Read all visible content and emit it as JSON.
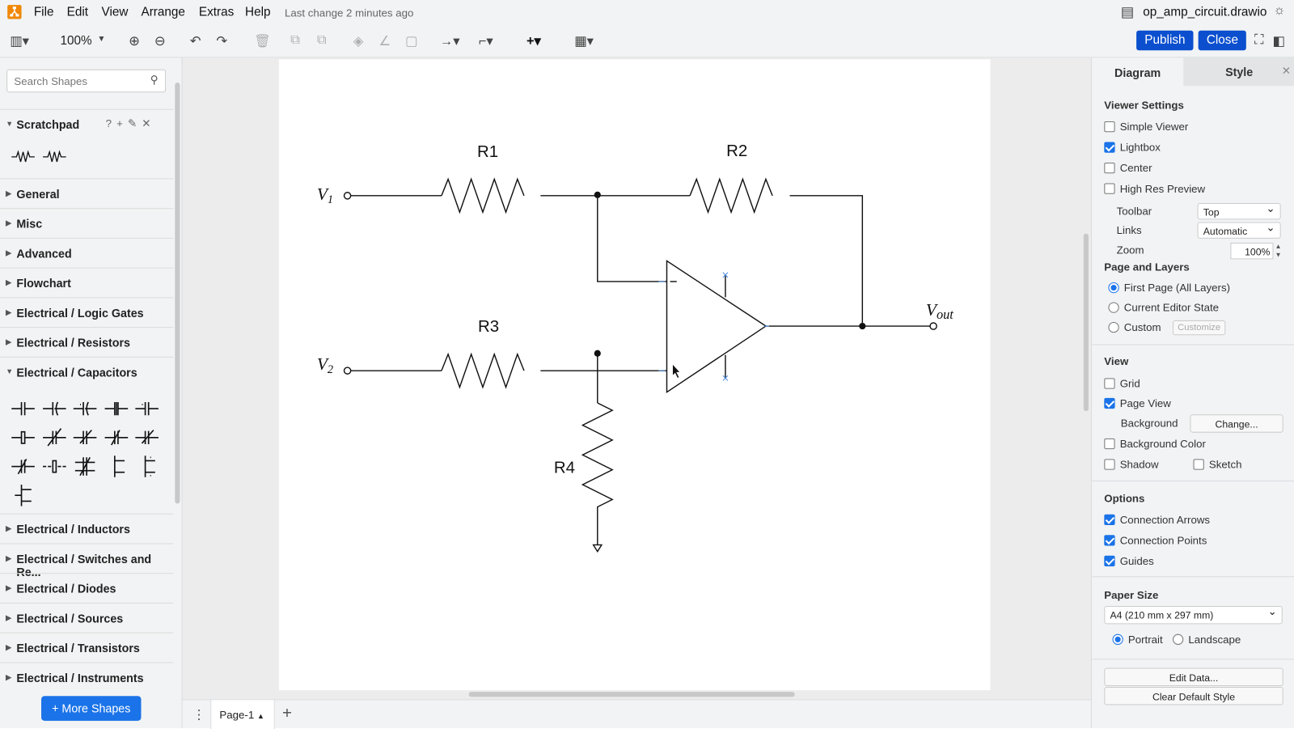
{
  "app": {
    "menus": [
      "File",
      "Edit",
      "View",
      "Arrange",
      "Extras",
      "Help"
    ],
    "last_change": "Last change 2 minutes ago",
    "file_name": "op_amp_circuit.drawio",
    "brand_color": "#f08705",
    "accent": "#0b4fcf"
  },
  "toolbar": {
    "zoom": "100%",
    "publish": "Publish",
    "close": "Close"
  },
  "sidebar": {
    "search_placeholder": "Search Shapes",
    "scratchpad": "Scratchpad",
    "sections": [
      "General",
      "Misc",
      "Advanced",
      "Flowchart",
      "Electrical / Logic Gates",
      "Electrical / Resistors",
      "Electrical / Capacitors",
      "Electrical / Inductors",
      "Electrical / Switches and Re...",
      "Electrical / Diodes",
      "Electrical / Sources",
      "Electrical / Transistors",
      "Electrical / Instruments"
    ],
    "more_shapes": "+ More Shapes"
  },
  "diagram": {
    "labels": {
      "r1": "R1",
      "r2": "R2",
      "r3": "R3",
      "r4": "R4",
      "v1": "V",
      "v1_sub": "1",
      "v2": "V",
      "v2_sub": "2",
      "vout": "V",
      "vout_sub": "out"
    }
  },
  "bottom": {
    "page_tab": "Page-1"
  },
  "panel": {
    "tabs": [
      "Diagram",
      "Style"
    ],
    "viewer_settings": "Viewer Settings",
    "viewer": [
      {
        "label": "Simple Viewer",
        "checked": false
      },
      {
        "label": "Lightbox",
        "checked": true
      },
      {
        "label": "Center",
        "checked": false
      },
      {
        "label": "High Res Preview",
        "checked": false
      }
    ],
    "toolbar_label": "Toolbar",
    "toolbar_value": "Top",
    "links_label": "Links",
    "links_value": "Automatic",
    "zoom_label": "Zoom",
    "zoom_value": "100%",
    "page_layers": "Page and Layers",
    "layers": [
      {
        "label": "First Page (All Layers)",
        "checked": true
      },
      {
        "label": "Current Editor State",
        "checked": false
      },
      {
        "label": "Custom",
        "checked": false
      }
    ],
    "customize": "Customize",
    "view": "View",
    "grid": "Grid",
    "page_view": "Page View",
    "background": "Background",
    "change": "Change...",
    "background_color": "Background Color",
    "shadow": "Shadow",
    "sketch": "Sketch",
    "options": "Options",
    "opts": [
      {
        "label": "Connection Arrows",
        "checked": true
      },
      {
        "label": "Connection Points",
        "checked": true
      },
      {
        "label": "Guides",
        "checked": true
      }
    ],
    "paper_size": "Paper Size",
    "paper_value": "A4 (210 mm x 297 mm)",
    "portrait": "Portrait",
    "landscape": "Landscape",
    "edit_data": "Edit Data...",
    "clear_style": "Clear Default Style"
  }
}
